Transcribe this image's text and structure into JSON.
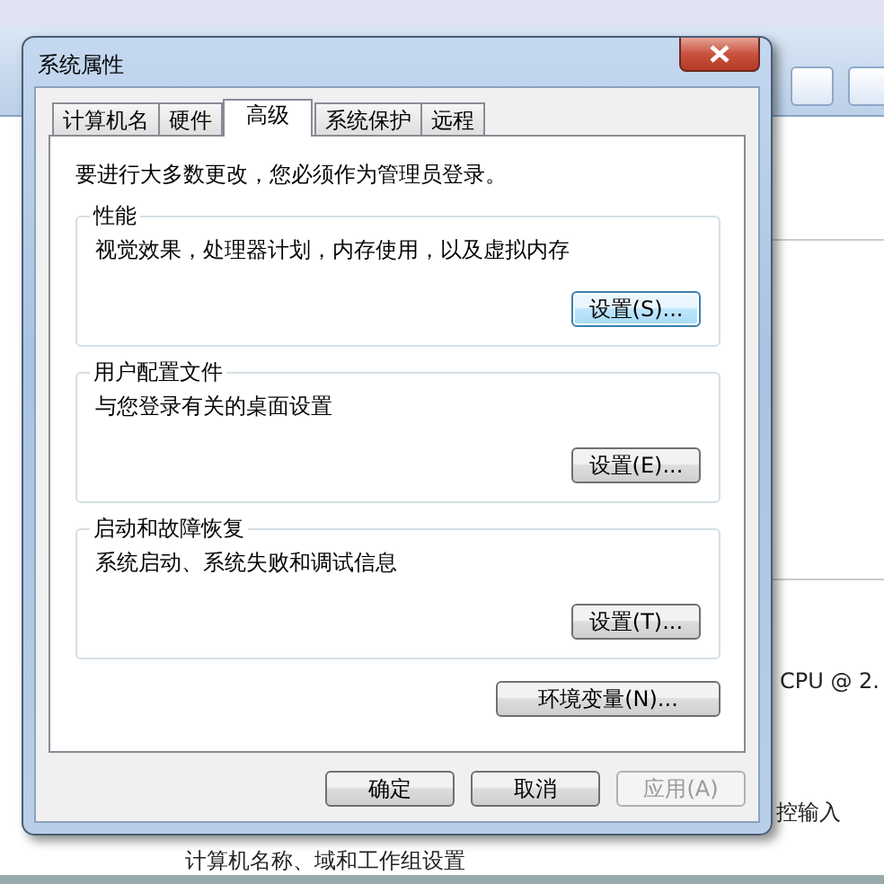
{
  "window": {
    "title": "系统属性"
  },
  "tabs": [
    {
      "label": "计算机名",
      "selected": false
    },
    {
      "label": "硬件",
      "selected": false
    },
    {
      "label": "高级",
      "selected": true
    },
    {
      "label": "系统保护",
      "selected": false
    },
    {
      "label": "远程",
      "selected": false
    }
  ],
  "notice": "要进行大多数更改，您必须作为管理员登录。",
  "groups": [
    {
      "title": "性能",
      "description": "视觉效果，处理器计划，内存使用，以及虚拟内存",
      "button": "设置(S)...",
      "focused": true
    },
    {
      "title": "用户配置文件",
      "description": "与您登录有关的桌面设置",
      "button": "设置(E)...",
      "focused": false
    },
    {
      "title": "启动和故障恢复",
      "description": "系统启动、系统失败和调试信息",
      "button": "设置(T)...",
      "focused": false
    }
  ],
  "env_button": "环境变量(N)...",
  "buttons": [
    {
      "label": "确定",
      "disabled": false
    },
    {
      "label": "取消",
      "disabled": false
    },
    {
      "label": "应用(A)",
      "disabled": true
    }
  ],
  "background_window": {
    "texts": [
      "CPU @ 2.",
      "控输入",
      "计算机名称、域和工作组设置"
    ]
  }
}
